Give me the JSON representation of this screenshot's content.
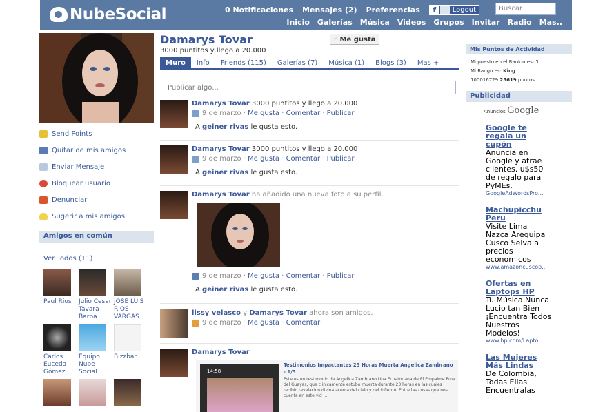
{
  "header": {
    "logo": "NubeSocial",
    "top_links": [
      "0 Notificaciones",
      "Mensajes (2)",
      "Preferencias"
    ],
    "fb_short": "f",
    "logout": "Logout",
    "search_placeholder": "Buscar",
    "nav": [
      "Inicio",
      "Galerías",
      "Música",
      "Videos",
      "Grupos",
      "Invitar",
      "Radio",
      "Mas.."
    ]
  },
  "left": {
    "actions": [
      "Send Points",
      "Quitar de mis amigos",
      "Enviar Mensaje",
      "Bloquear usuario",
      "Denunciar",
      "Sugerir a mis amigos"
    ],
    "friends_common_title": "Amigos en común",
    "ver_todos": "Ver Todos",
    "friend_count": "(11)",
    "friends": [
      {
        "name": "Paul Rios"
      },
      {
        "name": "Julio Cesar Tavara Barba"
      },
      {
        "name": "JOSE LUIS RIOS VARGAS"
      },
      {
        "name": "Carlos Euceda Gómez"
      },
      {
        "name": "Equipo Nube Social"
      },
      {
        "name": "Bizzbar"
      }
    ]
  },
  "profile": {
    "name": "Damarys Tovar",
    "tagline": "3000 puntitos y llego a 20.000",
    "like_button": "Me gusta",
    "tabs": [
      "Muro",
      "Info",
      "Friends (115)",
      "Galerías (7)",
      "Música (1)",
      "Blogs (3)",
      "Mas +"
    ],
    "post_placeholder": "Publicar algo...",
    "feed": [
      {
        "name": "Damarys Tovar",
        "text": "3000 puntitos y llego a 20.000",
        "date": "9 de marzo",
        "like": "Me gusta",
        "comment": "Comentar",
        "publish": "Publicar",
        "liker": "geiner rivas",
        "likes_suffix": "le gusta esto.",
        "likes_prefix": "A"
      },
      {
        "name": "Damarys Tovar",
        "text": "3000 puntitos y llego a 20.000",
        "date": "9 de marzo",
        "like": "Me gusta",
        "comment": "Comentar",
        "publish": "Publicar",
        "liker": "geiner rivas",
        "likes_suffix": "le gusta esto.",
        "likes_prefix": "A"
      },
      {
        "name": "Damarys Tovar",
        "text": "ha añadido una nueva foto a su perfil.",
        "date": "9 de marzo",
        "like": "Me gusta",
        "comment": "Comentar",
        "publish": "Publicar",
        "liker": "geiner rivas",
        "likes_suffix": "le gusta esto.",
        "likes_prefix": "A"
      },
      {
        "name1": "lissy velasco",
        "and": "y",
        "name2": "Damarys Tovar",
        "text": "ahora son amigos.",
        "date": "9 de marzo",
        "like": "Me gusta",
        "comment": "Comentar"
      },
      {
        "name": "Damarys Tovar",
        "video_title": "Testimonios Impactantes 23 Horas Muerta Angelica Zambrano - 1/5",
        "video_desc": "Este es un testimonio de Angelica Zambrano Una Ecuatoriana de El Empalme Prov. del Guayas, que clinicamente estubo muerta durante 23 horas en las cuales recibio revelacion divina acerca del cielo y del infierno. Entre las cosas que nos cuenta en este vid ...",
        "video_time": "14:58"
      }
    ]
  },
  "right": {
    "points_title": "Mis Puntos de Actividad",
    "rank_label": "Mi puesto en el Rankin es:",
    "rank_value": "1",
    "level_label": "Mi Rango es:",
    "level_value": "King",
    "points_prefix": "100016729",
    "points_value": "25619",
    "points_suffix": "puntos.",
    "ads_title": "Publicidad",
    "ads_by": "Anuncios",
    "google": "Google",
    "ads": [
      {
        "title": "Google te regala un cupón",
        "desc": "Anuncia en Google y atrae clientes. u$s50 de regalo para PyMEs.",
        "url": "GoogleAdWordsPro..."
      },
      {
        "title": "Machupicchu Peru",
        "desc": "Visite Lima Nazca Arequipa Cusco Selva a precios economicos",
        "url": "www.amazoncuscop..."
      },
      {
        "title": "Ofertas en Laptops HP",
        "desc": "Tu Música Nunca Lucio tan Bien ¡Encuentra Todos Nuestros Modelos!",
        "url": "www.hp.com/Lapto..."
      },
      {
        "title": "Las Mujeres Más Lindas",
        "desc": "De Colombia, Todas Ellas Encuentralas",
        "url": ""
      }
    ]
  },
  "colors": {
    "header": "#5a7aa3",
    "link": "#3b5998",
    "subhead": "#dbe3ed"
  }
}
